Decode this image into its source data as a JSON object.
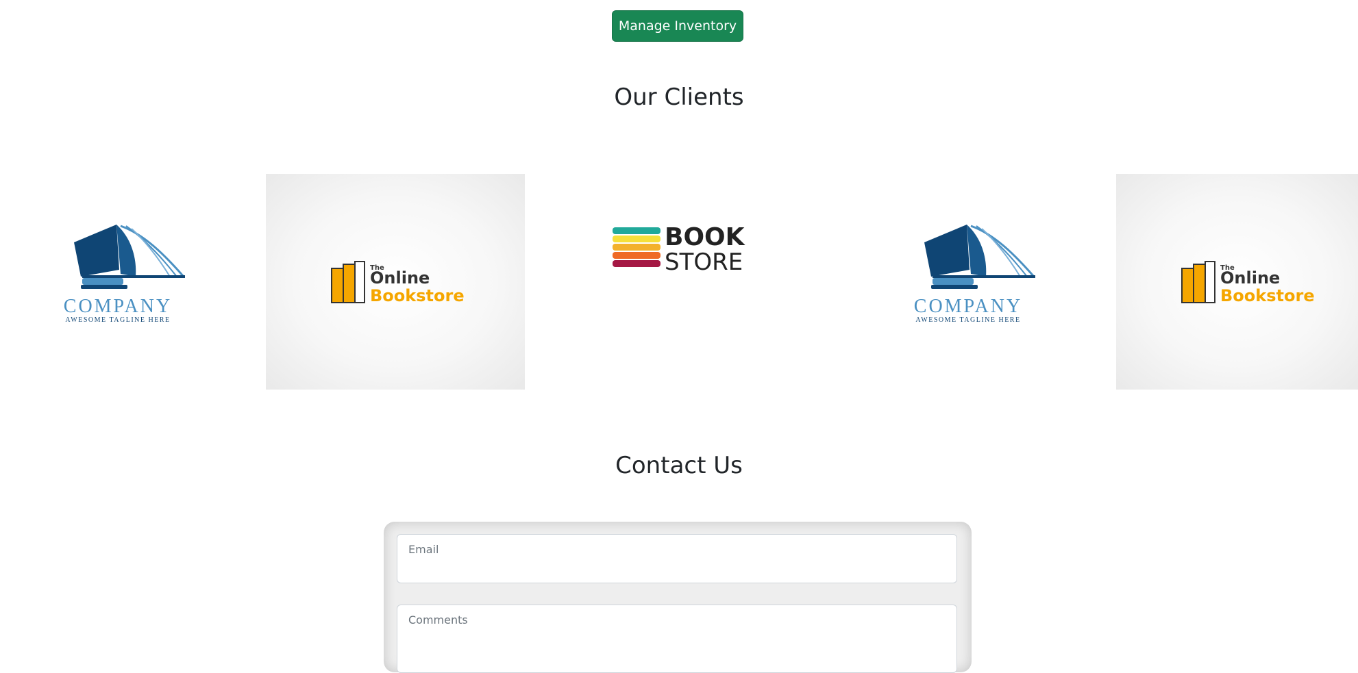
{
  "header": {
    "manage_inventory_label": "Manage Inventory"
  },
  "clients": {
    "title": "Our Clients",
    "logos": [
      {
        "name": "COMPANY",
        "tagline": "AWESOME TAGLINE HERE"
      },
      {
        "line1": "The",
        "line2": "Online",
        "line3": "Bookstore"
      },
      {
        "line1": "BOOK",
        "line2": "STORE"
      },
      {
        "name": "COMPANY",
        "tagline": "AWESOME TAGLINE HERE"
      },
      {
        "line1": "The",
        "line2": "Online",
        "line3": "Bookstore"
      }
    ]
  },
  "contact": {
    "title": "Contact Us",
    "email_label": "Email",
    "comments_label": "Comments"
  },
  "colors": {
    "primary_button": "#198754",
    "company_navy": "#0f4574",
    "company_light": "#4a90c2",
    "bookstore_orange": "#f5a600"
  }
}
